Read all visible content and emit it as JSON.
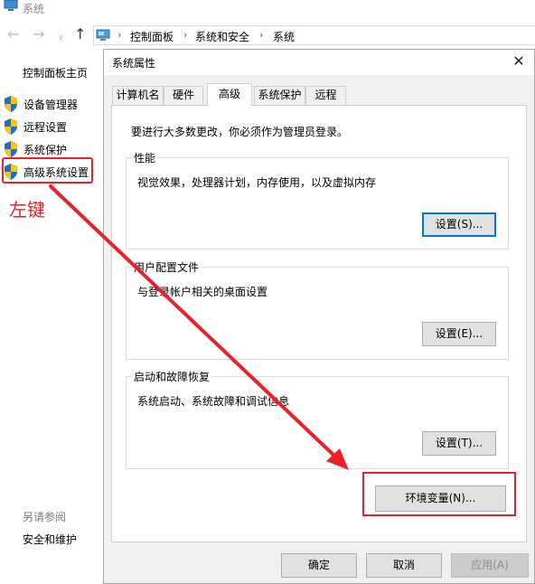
{
  "window": {
    "title": "系统",
    "address": {
      "crumbs": [
        "控制面板",
        "系统和安全",
        "系统"
      ]
    }
  },
  "sidebar": {
    "home": "控制面板主页",
    "items": [
      {
        "label": "设备管理器",
        "icon": "shield-icon"
      },
      {
        "label": "远程设置",
        "icon": "shield-icon"
      },
      {
        "label": "系统保护",
        "icon": "shield-icon"
      },
      {
        "label": "高级系统设置",
        "icon": "shield-icon"
      }
    ],
    "see_also": "另请参阅",
    "security": "安全和维护"
  },
  "annotation": {
    "left_click_label": "左键",
    "color": "#e8212a"
  },
  "dialog": {
    "title": "系统属性",
    "tabs": [
      {
        "label": "计算机名",
        "active": false
      },
      {
        "label": "硬件",
        "active": false
      },
      {
        "label": "高级",
        "active": true
      },
      {
        "label": "系统保护",
        "active": false
      },
      {
        "label": "远程",
        "active": false
      }
    ],
    "admin_note": "要进行大多数更改，你必须作为管理员登录。",
    "groups": {
      "performance": {
        "title": "性能",
        "desc": "视觉效果，处理器计划，内存使用，以及虚拟内存",
        "button": "设置(S)..."
      },
      "profile": {
        "title": "用户配置文件",
        "desc": "与登录帐户相关的桌面设置",
        "button": "设置(E)..."
      },
      "startup": {
        "title": "启动和故障恢复",
        "desc": "系统启动、系统故障和调试信息",
        "button": "设置(T)..."
      }
    },
    "env_button": "环境变量(N)...",
    "footer": {
      "ok": "确定",
      "cancel": "取消",
      "apply": "应用(A)"
    }
  },
  "colors": {
    "highlight_red": "#e8212a",
    "focus_blue": "#0078d7"
  }
}
